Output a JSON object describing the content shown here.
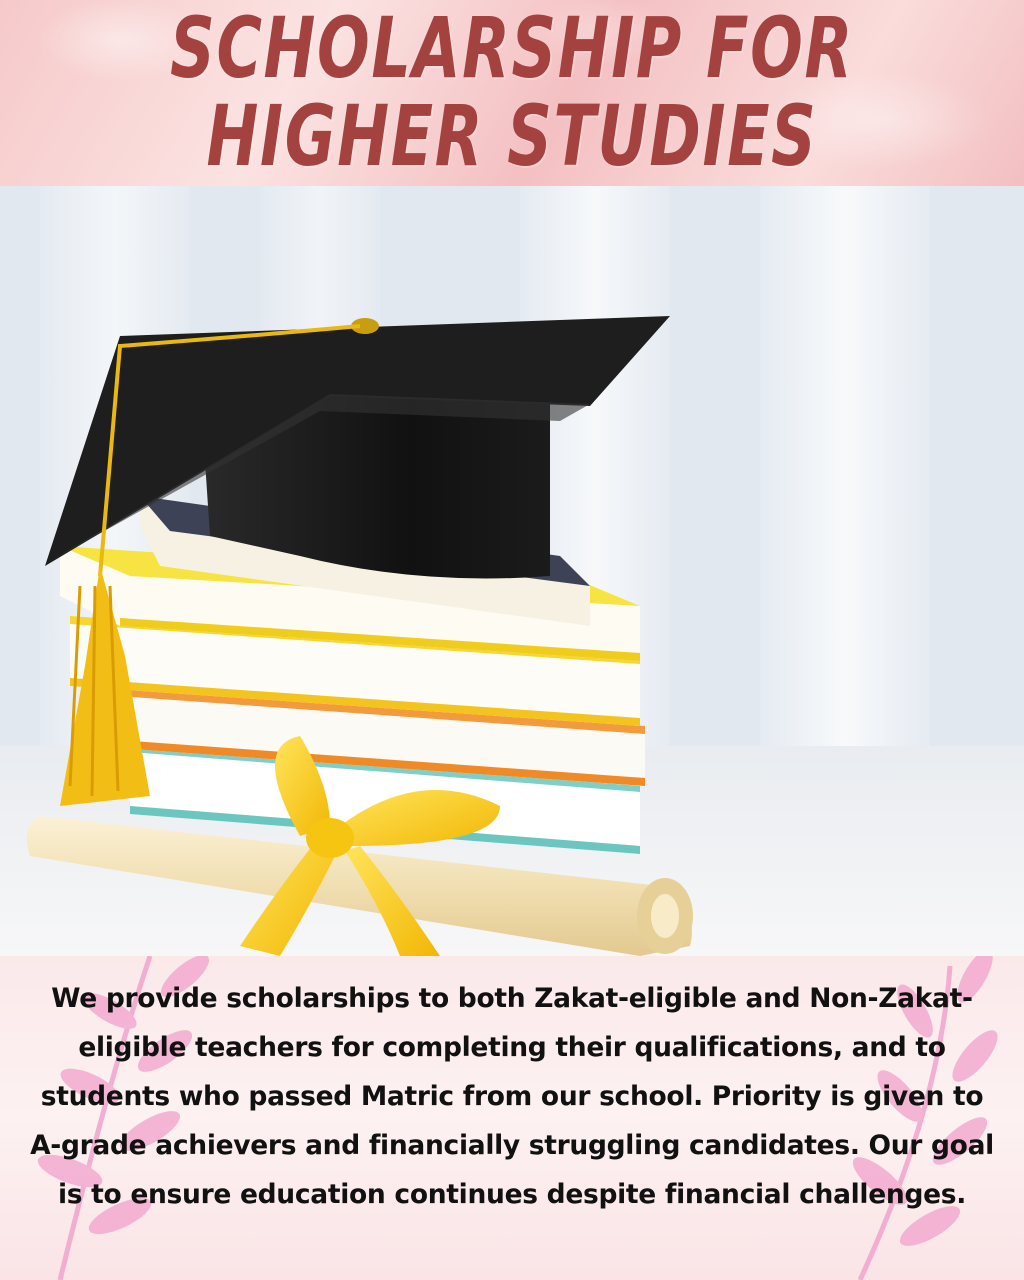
{
  "header": {
    "title_line1": "SCHOLARSHIP FOR",
    "title_line2": "HIGHER STUDIES"
  },
  "image": {
    "description_icon": "graduation-cap-books-diploma-icon"
  },
  "body": {
    "paragraph": "We provide scholarships to both Zakat-eligible and Non-Zakat-eligible teachers for completing their qualifications, and to students who passed Matric from our school. Priority is given to A-grade achievers and financially struggling candidates. Our goal is to ensure education continues despite financial challenges."
  },
  "colors": {
    "title": "#a3423f",
    "header_bg": "#f6c9c9",
    "text": "#111111",
    "leaf": "#f2a9cf"
  }
}
